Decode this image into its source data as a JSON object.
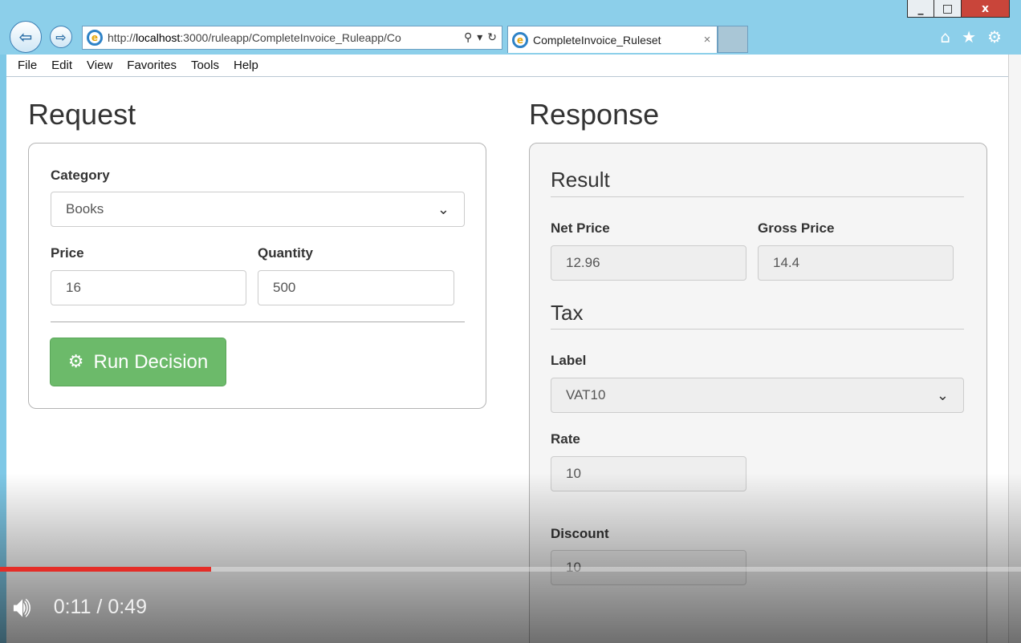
{
  "window": {
    "minimize": "_",
    "maximize": "□",
    "close": "x"
  },
  "browser": {
    "url_prefix": "http://",
    "url_host": "localhost",
    "url_rest": ":3000/ruleapp/CompleteInvoice_Ruleapp/Co",
    "tab_title": "CompleteInvoice_Ruleset",
    "tab_close": "×"
  },
  "menu": [
    "File",
    "Edit",
    "View",
    "Favorites",
    "Tools",
    "Help"
  ],
  "request": {
    "title": "Request",
    "category_label": "Category",
    "category_value": "Books",
    "price_label": "Price",
    "price_value": "16",
    "quantity_label": "Quantity",
    "quantity_value": "500",
    "run_button": "Run Decision"
  },
  "response": {
    "title": "Response",
    "result_heading": "Result",
    "net_price_label": "Net Price",
    "net_price_value": "12.96",
    "gross_price_label": "Gross Price",
    "gross_price_value": "14.4",
    "tax_heading": "Tax",
    "tax_label_label": "Label",
    "tax_label_value": "VAT10",
    "rate_label": "Rate",
    "rate_value": "10",
    "discount_label": "Discount",
    "discount_value": "10"
  },
  "video": {
    "time": "0:11 / 0:49",
    "progress": 0.207
  },
  "colors": {
    "run_button": "#6cba6a",
    "progress": "#e52d27"
  }
}
